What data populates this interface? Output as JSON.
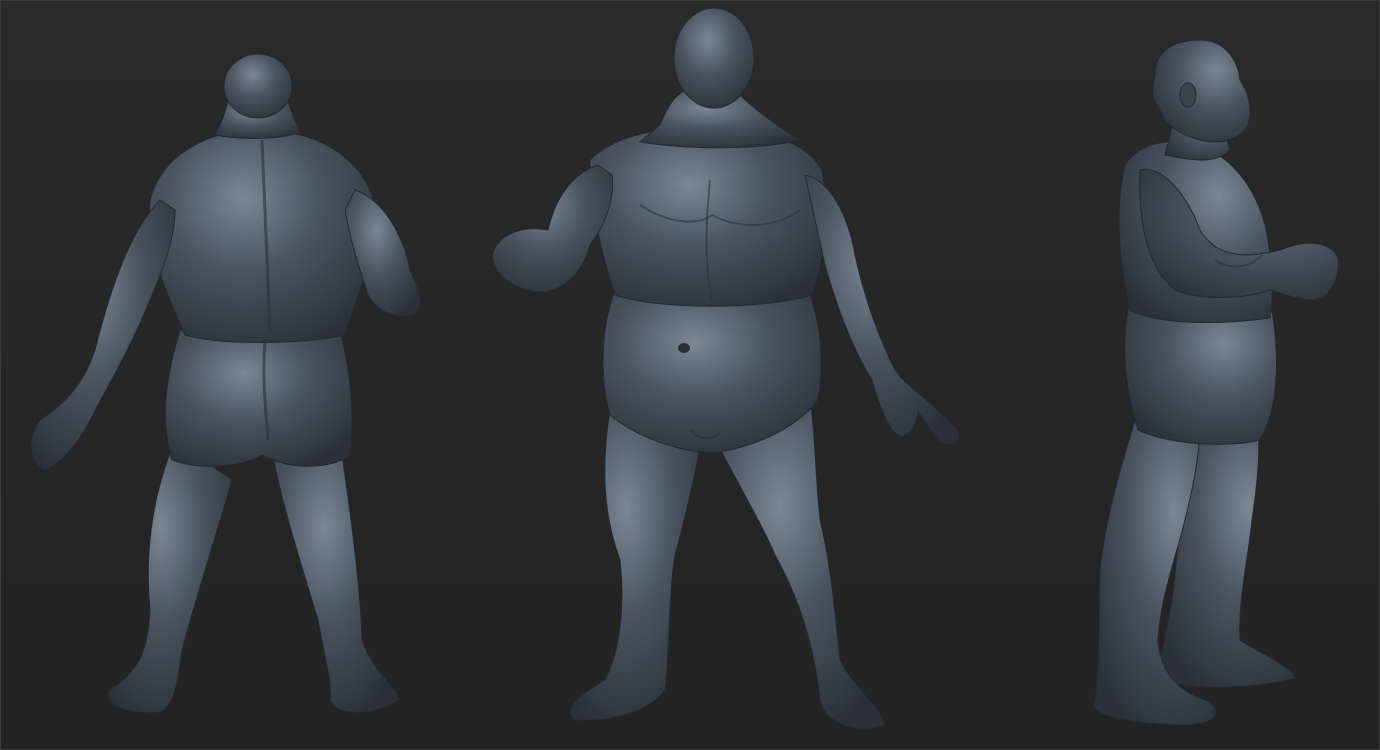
{
  "viewport": {
    "background_top": "#2a2a2a",
    "background_bottom": "#232323",
    "frame_color": "#3c3c3c"
  },
  "material": {
    "base": "#4a5560",
    "shadow": "#2a3138",
    "highlight": "#7a8894"
  },
  "models": [
    {
      "view": "back"
    },
    {
      "view": "front"
    },
    {
      "view": "side"
    }
  ]
}
